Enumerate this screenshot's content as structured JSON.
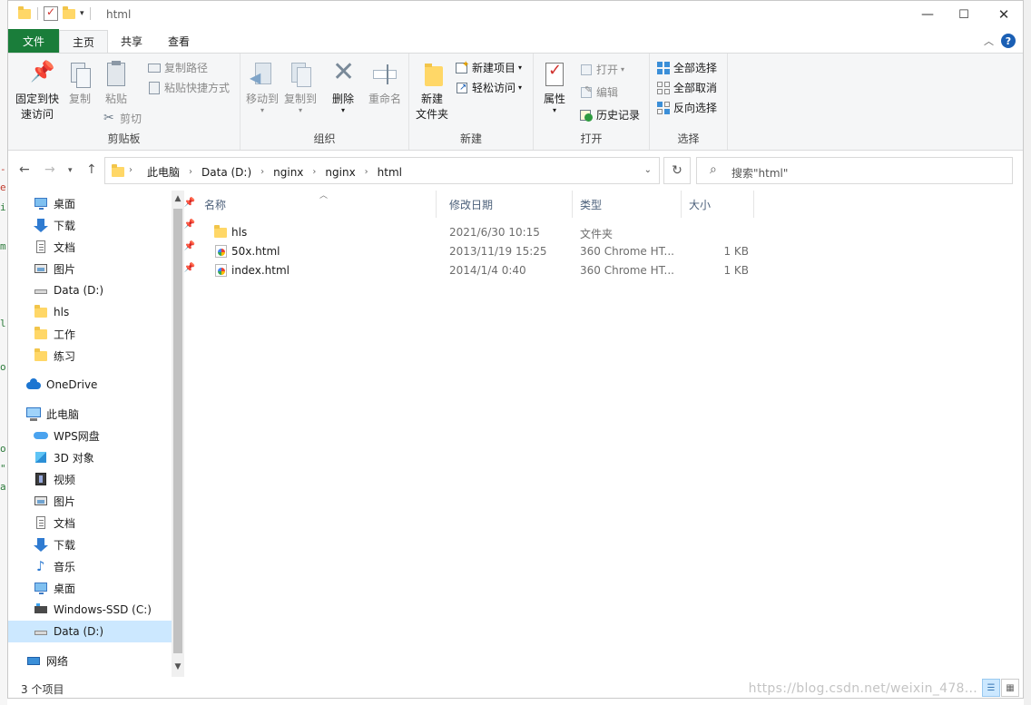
{
  "window": {
    "title": "html",
    "controls": [
      "minimize",
      "maximize",
      "close"
    ]
  },
  "tabs": [
    {
      "label": "文件"
    },
    {
      "label": "主页"
    },
    {
      "label": "共享"
    },
    {
      "label": "查看"
    }
  ],
  "ribbon": {
    "clipboard": {
      "group_label": "剪贴板",
      "pin_quick_access": "固定到快\n速访问",
      "copy": "复制",
      "paste": "粘贴",
      "copy_path": "复制路径",
      "paste_shortcut": "粘贴快捷方式",
      "cut": "剪切"
    },
    "organize": {
      "group_label": "组织",
      "move_to": "移动到",
      "copy_to": "复制到",
      "delete": "删除",
      "rename": "重命名"
    },
    "new": {
      "group_label": "新建",
      "new_folder": "新建\n文件夹",
      "new_item": "新建项目",
      "easy_access": "轻松访问"
    },
    "open": {
      "group_label": "打开",
      "properties": "属性",
      "open": "打开",
      "edit": "编辑",
      "history": "历史记录"
    },
    "select": {
      "group_label": "选择",
      "select_all": "全部选择",
      "select_none": "全部取消",
      "invert": "反向选择"
    }
  },
  "address": {
    "crumbs": [
      "此电脑",
      "Data (D:)",
      "nginx",
      "nginx",
      "html"
    ]
  },
  "search": {
    "placeholder": "搜索\"html\""
  },
  "sidebar": {
    "quick_access": [
      {
        "label": "桌面",
        "icon": "desktop-icon",
        "pinned": true
      },
      {
        "label": "下载",
        "icon": "download-icon",
        "pinned": true
      },
      {
        "label": "文档",
        "icon": "document-icon",
        "pinned": true
      },
      {
        "label": "图片",
        "icon": "picture-icon",
        "pinned": true
      },
      {
        "label": "Data (D:)",
        "icon": "drive-icon",
        "pinned": false
      },
      {
        "label": "hls",
        "icon": "folder-icon",
        "pinned": false
      },
      {
        "label": "工作",
        "icon": "folder-icon",
        "pinned": false
      },
      {
        "label": "练习",
        "icon": "folder-icon",
        "pinned": false
      }
    ],
    "onedrive": "OneDrive",
    "this_pc": "此电脑",
    "pc_items": [
      {
        "label": "WPS网盘",
        "icon": "wps-cloud-icon"
      },
      {
        "label": "3D 对象",
        "icon": "3d-objects-icon"
      },
      {
        "label": "视频",
        "icon": "video-icon"
      },
      {
        "label": "图片",
        "icon": "picture-icon"
      },
      {
        "label": "文档",
        "icon": "document-icon"
      },
      {
        "label": "下载",
        "icon": "download-icon"
      },
      {
        "label": "音乐",
        "icon": "music-icon"
      },
      {
        "label": "桌面",
        "icon": "desktop-icon"
      },
      {
        "label": "Windows-SSD (C:)",
        "icon": "ssd-drive-icon"
      },
      {
        "label": "Data (D:)",
        "icon": "drive-icon",
        "selected": true
      }
    ],
    "network": "网络"
  },
  "files": {
    "columns": [
      "名称",
      "修改日期",
      "类型",
      "大小"
    ],
    "rows": [
      {
        "name": "hls",
        "date": "2021/6/30 10:15",
        "type": "文件夹",
        "size": "",
        "icon": "folder-icon"
      },
      {
        "name": "50x.html",
        "date": "2013/11/19 15:25",
        "type": "360 Chrome HT...",
        "size": "1 KB",
        "icon": "html-file-icon"
      },
      {
        "name": "index.html",
        "date": "2014/1/4 0:40",
        "type": "360 Chrome HT...",
        "size": "1 KB",
        "icon": "html-file-icon"
      }
    ]
  },
  "status": {
    "count": "3 个项目",
    "watermark": "https://blog.csdn.net/weixin_478..."
  }
}
